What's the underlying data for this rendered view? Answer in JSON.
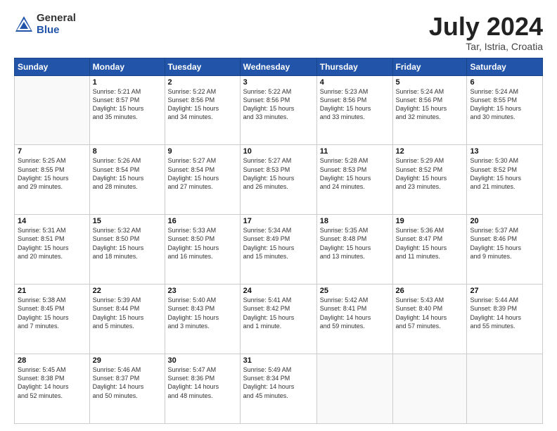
{
  "logo": {
    "general": "General",
    "blue": "Blue"
  },
  "title": {
    "month_year": "July 2024",
    "location": "Tar, Istria, Croatia"
  },
  "weekdays": [
    "Sunday",
    "Monday",
    "Tuesday",
    "Wednesday",
    "Thursday",
    "Friday",
    "Saturday"
  ],
  "weeks": [
    [
      {
        "day": "",
        "info": ""
      },
      {
        "day": "1",
        "info": "Sunrise: 5:21 AM\nSunset: 8:57 PM\nDaylight: 15 hours\nand 35 minutes."
      },
      {
        "day": "2",
        "info": "Sunrise: 5:22 AM\nSunset: 8:56 PM\nDaylight: 15 hours\nand 34 minutes."
      },
      {
        "day": "3",
        "info": "Sunrise: 5:22 AM\nSunset: 8:56 PM\nDaylight: 15 hours\nand 33 minutes."
      },
      {
        "day": "4",
        "info": "Sunrise: 5:23 AM\nSunset: 8:56 PM\nDaylight: 15 hours\nand 33 minutes."
      },
      {
        "day": "5",
        "info": "Sunrise: 5:24 AM\nSunset: 8:56 PM\nDaylight: 15 hours\nand 32 minutes."
      },
      {
        "day": "6",
        "info": "Sunrise: 5:24 AM\nSunset: 8:55 PM\nDaylight: 15 hours\nand 30 minutes."
      }
    ],
    [
      {
        "day": "7",
        "info": "Sunrise: 5:25 AM\nSunset: 8:55 PM\nDaylight: 15 hours\nand 29 minutes."
      },
      {
        "day": "8",
        "info": "Sunrise: 5:26 AM\nSunset: 8:54 PM\nDaylight: 15 hours\nand 28 minutes."
      },
      {
        "day": "9",
        "info": "Sunrise: 5:27 AM\nSunset: 8:54 PM\nDaylight: 15 hours\nand 27 minutes."
      },
      {
        "day": "10",
        "info": "Sunrise: 5:27 AM\nSunset: 8:53 PM\nDaylight: 15 hours\nand 26 minutes."
      },
      {
        "day": "11",
        "info": "Sunrise: 5:28 AM\nSunset: 8:53 PM\nDaylight: 15 hours\nand 24 minutes."
      },
      {
        "day": "12",
        "info": "Sunrise: 5:29 AM\nSunset: 8:52 PM\nDaylight: 15 hours\nand 23 minutes."
      },
      {
        "day": "13",
        "info": "Sunrise: 5:30 AM\nSunset: 8:52 PM\nDaylight: 15 hours\nand 21 minutes."
      }
    ],
    [
      {
        "day": "14",
        "info": "Sunrise: 5:31 AM\nSunset: 8:51 PM\nDaylight: 15 hours\nand 20 minutes."
      },
      {
        "day": "15",
        "info": "Sunrise: 5:32 AM\nSunset: 8:50 PM\nDaylight: 15 hours\nand 18 minutes."
      },
      {
        "day": "16",
        "info": "Sunrise: 5:33 AM\nSunset: 8:50 PM\nDaylight: 15 hours\nand 16 minutes."
      },
      {
        "day": "17",
        "info": "Sunrise: 5:34 AM\nSunset: 8:49 PM\nDaylight: 15 hours\nand 15 minutes."
      },
      {
        "day": "18",
        "info": "Sunrise: 5:35 AM\nSunset: 8:48 PM\nDaylight: 15 hours\nand 13 minutes."
      },
      {
        "day": "19",
        "info": "Sunrise: 5:36 AM\nSunset: 8:47 PM\nDaylight: 15 hours\nand 11 minutes."
      },
      {
        "day": "20",
        "info": "Sunrise: 5:37 AM\nSunset: 8:46 PM\nDaylight: 15 hours\nand 9 minutes."
      }
    ],
    [
      {
        "day": "21",
        "info": "Sunrise: 5:38 AM\nSunset: 8:45 PM\nDaylight: 15 hours\nand 7 minutes."
      },
      {
        "day": "22",
        "info": "Sunrise: 5:39 AM\nSunset: 8:44 PM\nDaylight: 15 hours\nand 5 minutes."
      },
      {
        "day": "23",
        "info": "Sunrise: 5:40 AM\nSunset: 8:43 PM\nDaylight: 15 hours\nand 3 minutes."
      },
      {
        "day": "24",
        "info": "Sunrise: 5:41 AM\nSunset: 8:42 PM\nDaylight: 15 hours\nand 1 minute."
      },
      {
        "day": "25",
        "info": "Sunrise: 5:42 AM\nSunset: 8:41 PM\nDaylight: 14 hours\nand 59 minutes."
      },
      {
        "day": "26",
        "info": "Sunrise: 5:43 AM\nSunset: 8:40 PM\nDaylight: 14 hours\nand 57 minutes."
      },
      {
        "day": "27",
        "info": "Sunrise: 5:44 AM\nSunset: 8:39 PM\nDaylight: 14 hours\nand 55 minutes."
      }
    ],
    [
      {
        "day": "28",
        "info": "Sunrise: 5:45 AM\nSunset: 8:38 PM\nDaylight: 14 hours\nand 52 minutes."
      },
      {
        "day": "29",
        "info": "Sunrise: 5:46 AM\nSunset: 8:37 PM\nDaylight: 14 hours\nand 50 minutes."
      },
      {
        "day": "30",
        "info": "Sunrise: 5:47 AM\nSunset: 8:36 PM\nDaylight: 14 hours\nand 48 minutes."
      },
      {
        "day": "31",
        "info": "Sunrise: 5:49 AM\nSunset: 8:34 PM\nDaylight: 14 hours\nand 45 minutes."
      },
      {
        "day": "",
        "info": ""
      },
      {
        "day": "",
        "info": ""
      },
      {
        "day": "",
        "info": ""
      }
    ]
  ]
}
